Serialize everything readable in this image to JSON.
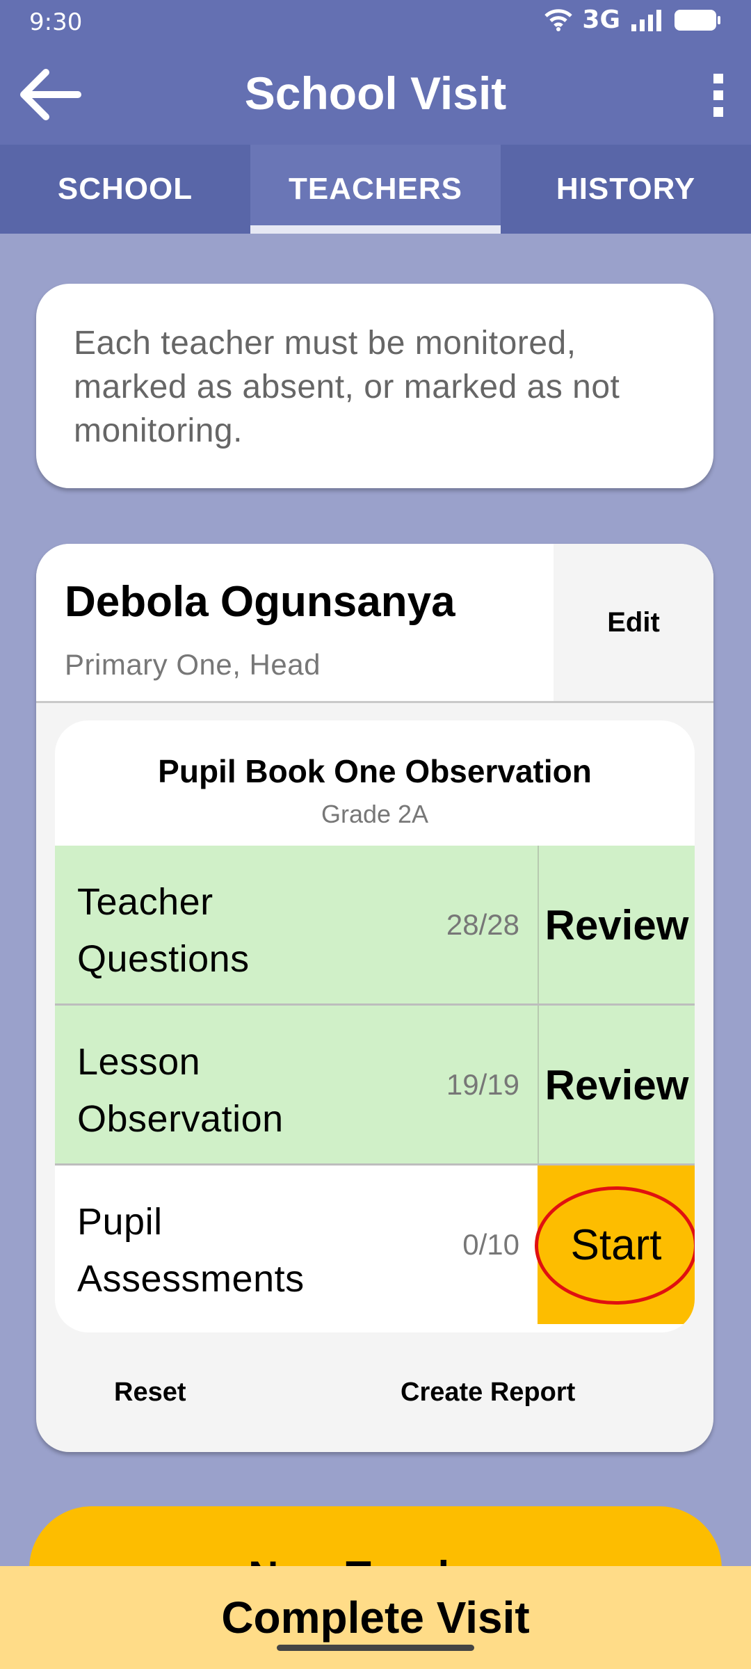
{
  "status_bar": {
    "time": "9:30",
    "network": "3G"
  },
  "app_bar": {
    "title": "School Visit"
  },
  "tabs": [
    {
      "label": "SCHOOL",
      "active": false
    },
    {
      "label": "TEACHERS",
      "active": true
    },
    {
      "label": "HISTORY",
      "active": false
    }
  ],
  "info_message": "Each teacher must be monitored, marked as absent, or marked as not monitoring.",
  "teacher": {
    "name": "Debola Ogunsanya",
    "subtitle": "Primary One, Head",
    "edit_label": "Edit",
    "observation": {
      "title": "Pupil Book One Observation",
      "grade": "Grade 2A",
      "rows": [
        {
          "label_line1": "Teacher",
          "label_line2": "Questions",
          "count": "28/28",
          "action": "Review",
          "status": "complete"
        },
        {
          "label_line1": "Lesson",
          "label_line2": "Observation",
          "count": "19/19",
          "action": "Review",
          "status": "complete"
        },
        {
          "label_line1": "Pupil",
          "label_line2": "Assessments",
          "count": "0/10",
          "action": "Start",
          "status": "pending"
        }
      ]
    },
    "reset_label": "Reset",
    "report_label": "Create Report"
  },
  "new_teacher_label": "New Teacher",
  "complete_visit_label": "Complete Visit",
  "colors": {
    "app_bar": "#6470b2",
    "tab_bar": "#5966a8",
    "background": "#9aa1cb",
    "complete_row": "#d0f0c8",
    "accent": "#fdbd00",
    "bottom_bar": "#ffdc88",
    "highlight_ring": "#e01010"
  }
}
